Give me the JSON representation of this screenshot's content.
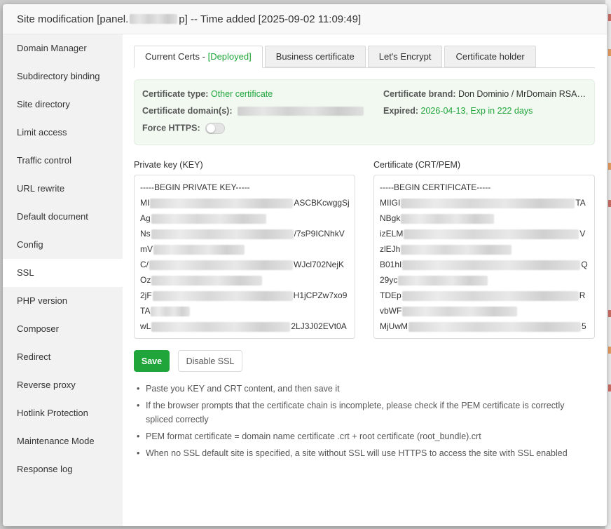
{
  "header": {
    "title_prefix": "Site modification [panel.",
    "title_mid": "p] -- Time added [2025-09-02 11:09:49]"
  },
  "sidebar": {
    "items": [
      {
        "label": "Domain Manager"
      },
      {
        "label": "Subdirectory binding"
      },
      {
        "label": "Site directory"
      },
      {
        "label": "Limit access"
      },
      {
        "label": "Traffic control"
      },
      {
        "label": "URL rewrite"
      },
      {
        "label": "Default document"
      },
      {
        "label": "Config"
      },
      {
        "label": "SSL"
      },
      {
        "label": "PHP version"
      },
      {
        "label": "Composer"
      },
      {
        "label": "Redirect"
      },
      {
        "label": "Reverse proxy"
      },
      {
        "label": "Hotlink Protection"
      },
      {
        "label": "Maintenance Mode"
      },
      {
        "label": "Response log"
      }
    ],
    "active_label": "SSL"
  },
  "tabs": {
    "current_label": "Current Certs - ",
    "current_status": "[Deployed]",
    "business": "Business certificate",
    "letsencrypt": "Let's Encrypt",
    "holder": "Certificate holder"
  },
  "cert_info": {
    "type_label": "Certificate type:",
    "type_value": "Other certificate",
    "domain_label": "Certificate domain(s):",
    "force_https_label": "Force HTTPS:",
    "brand_label": "Certificate brand:",
    "brand_value": "Don Dominio / MrDomain RSA…",
    "expired_label": "Expired:",
    "expired_value": "2026-04-13, Exp in 222 days"
  },
  "key_section": {
    "label": "Private key (KEY)",
    "lines": [
      {
        "pre": "-----BEGIN PRIVATE KEY-----",
        "post": ""
      },
      {
        "pre": "MI",
        "post": "ASCBKcwggSj"
      },
      {
        "pre": "Ag",
        "post": ""
      },
      {
        "pre": "Ns",
        "post": "/7sP9ICNhkV"
      },
      {
        "pre": "mV",
        "post": ""
      },
      {
        "pre": "C/",
        "post": "WJcl702NejK"
      },
      {
        "pre": "Oz",
        "post": ""
      },
      {
        "pre": "2jF",
        "post": "H1jCPZw7xo9"
      },
      {
        "pre": "TA",
        "post": ""
      },
      {
        "pre": "wL",
        "post": "2LJ3J02EVt0A"
      }
    ]
  },
  "cert_section": {
    "label": "Certificate (CRT/PEM)",
    "lines": [
      {
        "pre": "-----BEGIN CERTIFICATE-----",
        "post": ""
      },
      {
        "pre": "MIIGI",
        "post": "TA"
      },
      {
        "pre": "NBgk",
        "post": ""
      },
      {
        "pre": "izELM",
        "post": "V"
      },
      {
        "pre": "zlEJh",
        "post": ""
      },
      {
        "pre": "B01hI",
        "post": "Q"
      },
      {
        "pre": "29yc",
        "post": ""
      },
      {
        "pre": "TDEp",
        "post": "R"
      },
      {
        "pre": "vbWF",
        "post": ""
      },
      {
        "pre": "MjUwM",
        "post": "5"
      }
    ]
  },
  "buttons": {
    "save": "Save",
    "disable": "Disable SSL"
  },
  "tips": [
    "Paste you KEY and CRT content, and then save it",
    "If the browser prompts that the certificate chain is incomplete, please check if the PEM certificate is correctly spliced correctly",
    "PEM format certificate = domain name certificate .crt + root certificate (root_bundle).crt",
    "When no SSL default site is specified, a site without SSL will use HTTPS to access the site with SSL enabled"
  ],
  "colors": {
    "accent_green": "#20a53a",
    "info_bg": "#f1f9f1"
  }
}
